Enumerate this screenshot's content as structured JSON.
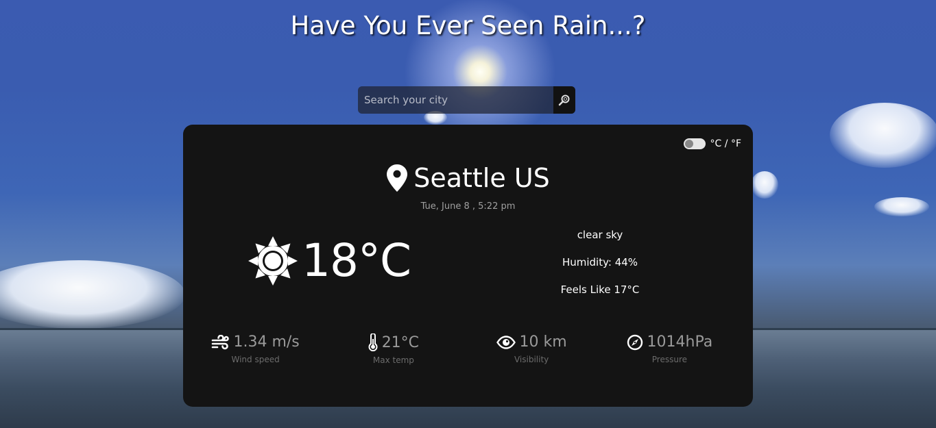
{
  "title": "Have You Ever Seen Rain...?",
  "search": {
    "placeholder": "Search your city",
    "button_icon": "search-icon"
  },
  "unit_toggle": {
    "label": "°C / °F",
    "state": "celsius"
  },
  "location": {
    "icon": "location-pin-icon",
    "city": "Seattle US"
  },
  "date": "Tue, June 8 , 5:22 pm",
  "current": {
    "icon": "sun-icon",
    "temperature": "18°C"
  },
  "details": {
    "description": "clear sky",
    "humidity": "Humidity: 44%",
    "feels_like": "Feels Like 17°C"
  },
  "stats": [
    {
      "icon": "wind-icon",
      "value": "1.34 m/s",
      "label": "Wind speed"
    },
    {
      "icon": "thermometer-icon",
      "value": "21°C",
      "label": "Max temp"
    },
    {
      "icon": "eye-icon",
      "value": "10 km",
      "label": "Visibility"
    },
    {
      "icon": "compass-icon",
      "value": "1014hPa",
      "label": "Pressure"
    }
  ],
  "colors": {
    "card_bg": "#141414",
    "text": "#ffffff",
    "muted": "#9a9a9a"
  }
}
